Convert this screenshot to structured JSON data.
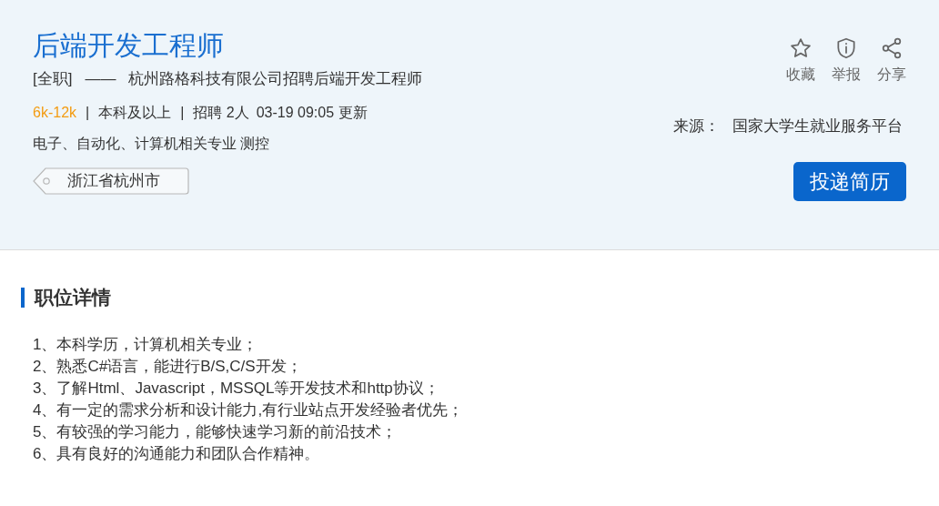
{
  "job": {
    "title": "后端开发工程师",
    "type": "[全职]",
    "dash": "——",
    "subtitle": "杭州路格科技有限公司招聘后端开发工程师",
    "meta": [
      {
        "kind": "salary",
        "text": "6k-12k"
      },
      {
        "kind": "sep",
        "text": "|"
      },
      {
        "kind": "plain",
        "text": "本科及以上"
      },
      {
        "kind": "sep",
        "text": "|"
      },
      {
        "kind": "plain",
        "text": "招聘 2人"
      },
      {
        "kind": "plain",
        "text": "03-19 09:05 更新"
      }
    ],
    "majors": "电子、自动化、计算机相关专业 测控",
    "location": "浙江省杭州市"
  },
  "actions": [
    {
      "kind": "star",
      "label": "收藏"
    },
    {
      "kind": "shield",
      "label": "举报"
    },
    {
      "kind": "share",
      "label": "分享"
    }
  ],
  "source": {
    "label": "来源：",
    "value": "国家大学生就业服务平台"
  },
  "apply_button": "投递简历",
  "details": {
    "heading": "职位详情",
    "lines": [
      "1、本科学历，计算机相关专业；",
      "2、熟悉C#语言，能进行B/S,C/S开发；",
      "3、了解Html、Javascript，MSSQL等开发技术和http协议；",
      "4、有一定的需求分析和设计能力,有行业站点开发经验者优先；",
      "5、有较强的学习能力，能够快速学习新的前沿技术；",
      "6、具有良好的沟通能力和团队合作精神。"
    ]
  }
}
